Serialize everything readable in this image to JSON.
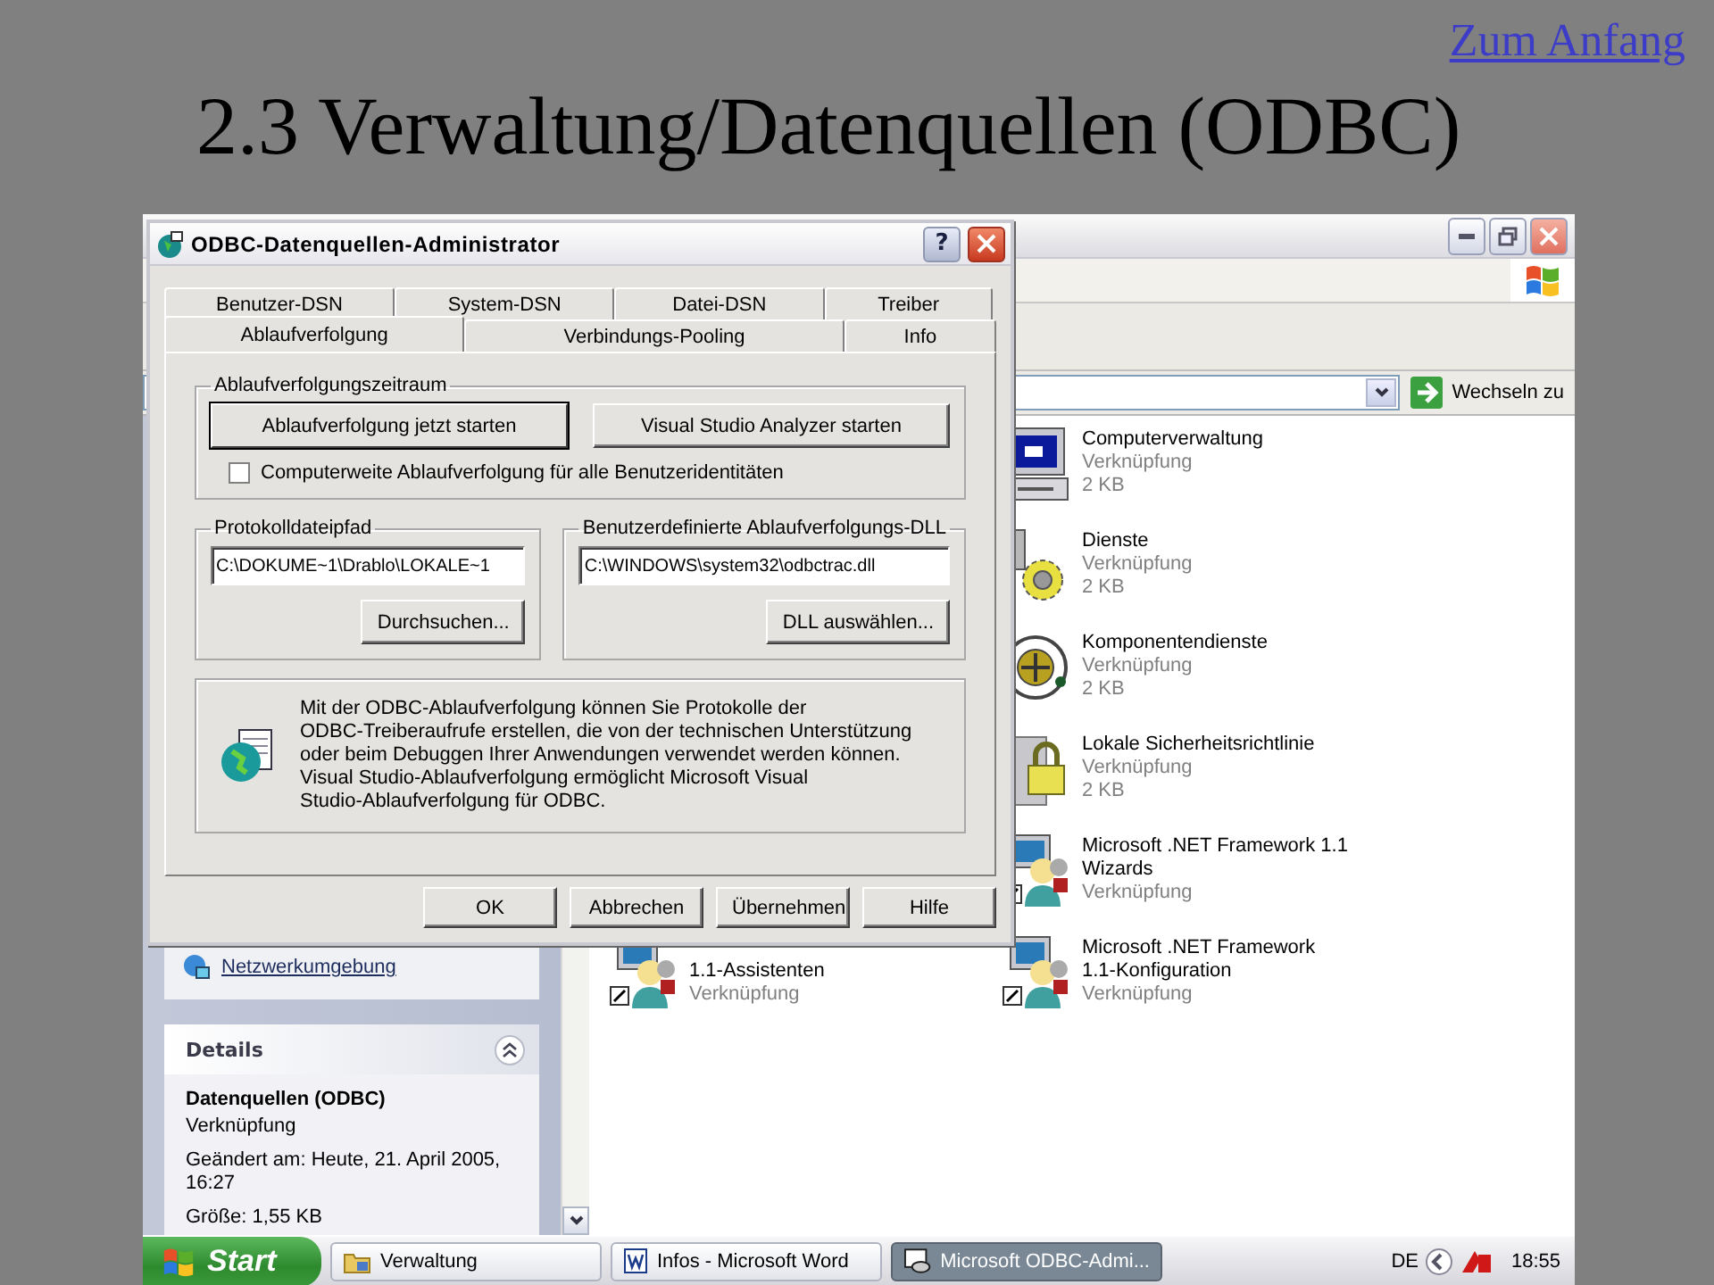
{
  "slide": {
    "link": "Zum Anfang",
    "title": "2.3 Verwaltung/Datenquellen (ODBC)"
  },
  "explorer": {
    "go_label": "Wechseln zu",
    "tasks": [
      {
        "label": "Netzwerkumgebung"
      }
    ],
    "details": {
      "heading": "Details",
      "expanded": true,
      "name": "Datenquellen (ODBC)",
      "type": "Verknüpfung",
      "modified": "Geändert am: Heute, 21. April 2005, 16:27",
      "size": "Größe: 1,55 KB"
    },
    "files_left": [
      {
        "kind": "dotnet",
        "lines": [
          "1.1-Assistenten"
        ],
        "info": [
          "Verknüpfung"
        ]
      }
    ],
    "files_right": [
      {
        "kind": "computer",
        "lines": [
          "Computerverwaltung"
        ],
        "info": [
          "Verknüpfung",
          "2 KB"
        ]
      },
      {
        "kind": "services",
        "lines": [
          "Dienste"
        ],
        "info": [
          "Verknüpfung",
          "2 KB"
        ]
      },
      {
        "kind": "components",
        "lines": [
          "Komponentendienste"
        ],
        "info": [
          "Verknüpfung",
          "2 KB"
        ]
      },
      {
        "kind": "security",
        "lines": [
          "Lokale Sicherheitsrichtlinie"
        ],
        "info": [
          "Verknüpfung",
          "2 KB"
        ]
      },
      {
        "kind": "dotnet",
        "lines": [
          "Microsoft .NET Framework 1.1",
          "Wizards"
        ],
        "info": [
          "Verknüpfung"
        ]
      },
      {
        "kind": "dotnet",
        "lines": [
          "Microsoft .NET Framework",
          "1.1-Konfiguration"
        ],
        "info": [
          "Verknüpfung"
        ]
      }
    ]
  },
  "dialog": {
    "title": "ODBC-Datenquellen-Administrator",
    "help": "?",
    "tabs_row1": [
      {
        "label": "Benutzer-DSN",
        "selected": false
      },
      {
        "label": "System-DSN",
        "selected": false
      },
      {
        "label": "Datei-DSN",
        "selected": false
      },
      {
        "label": "Treiber",
        "selected": false
      }
    ],
    "tabs_row2": [
      {
        "label": "Ablaufverfolgung",
        "selected": true
      },
      {
        "label": "Verbindungs-Pooling",
        "selected": false
      },
      {
        "label": "Info",
        "selected": false
      }
    ],
    "period": {
      "label": "Ablaufverfolgungszeitraum",
      "buttons": [
        {
          "label": "Ablaufverfolgung jetzt starten",
          "default": true
        },
        {
          "label": "Visual Studio Analyzer starten",
          "default": false
        }
      ],
      "checkbox": {
        "label": "Computerweite Ablaufverfolgung für alle Benutzeridentitäten",
        "checked": false
      }
    },
    "log_path": {
      "label": "Protokolldateipfad",
      "value": "C:\\DOKUME~1\\Drablo\\LOKALE~1",
      "button": "Durchsuchen..."
    },
    "custom_dll": {
      "label": "Benutzerdefinierte Ablaufverfolgungs-DLL",
      "value": "C:\\WINDOWS\\system32\\odbctrac.dll",
      "button": "DLL auswählen..."
    },
    "info_lines": [
      "Mit der ODBC-Ablaufverfolgung können Sie Protokolle der",
      "ODBC-Treiberaufrufe erstellen, die von der technischen Unterstützung",
      "oder beim Debuggen Ihrer Anwendungen verwendet werden können.",
      "Visual Studio-Ablaufverfolgung ermöglicht Microsoft Visual",
      "Studio-Ablaufverfolgung für ODBC."
    ],
    "footer_buttons": [
      "OK",
      "Abbrechen",
      "Übernehmen",
      "Hilfe"
    ]
  },
  "taskbar": {
    "start": "Start",
    "tasks": [
      {
        "kind": "folder",
        "label": "Verwaltung",
        "selected": false
      },
      {
        "kind": "word",
        "label": "Infos - Microsoft Word",
        "selected": false
      },
      {
        "kind": "odbc",
        "label": "Microsoft ODBC-Admi...",
        "selected": true
      }
    ],
    "language": "DE",
    "clock": "18:55"
  }
}
